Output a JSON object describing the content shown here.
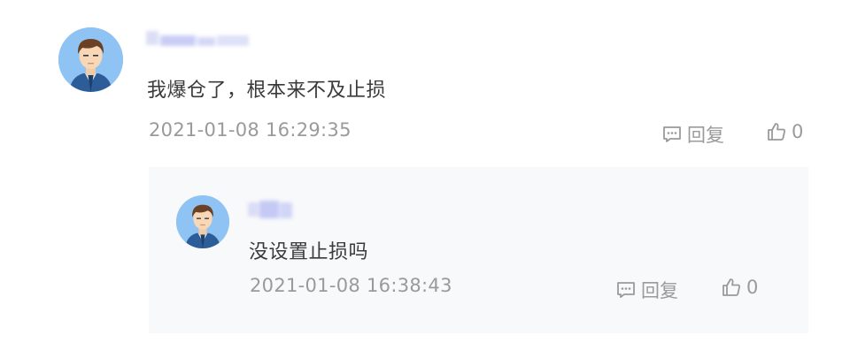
{
  "comment": {
    "avatar_icon": "user-avatar-icon",
    "text": "我爆仓了，根本来不及止损",
    "timestamp": "2021-01-08 16:29:35",
    "reply_label": "回复",
    "like_count": "0"
  },
  "reply": {
    "avatar_icon": "user-avatar-icon",
    "text": "没设置止损吗",
    "timestamp": "2021-01-08 16:38:43",
    "reply_label": "回复",
    "like_count": "0"
  },
  "colors": {
    "avatar_bg": "#8fc3f3",
    "text": "#3a3a3a",
    "muted": "#9a9a9a",
    "reply_bg": "#f8f9fb",
    "blurred_name": "#c9cdf6"
  }
}
